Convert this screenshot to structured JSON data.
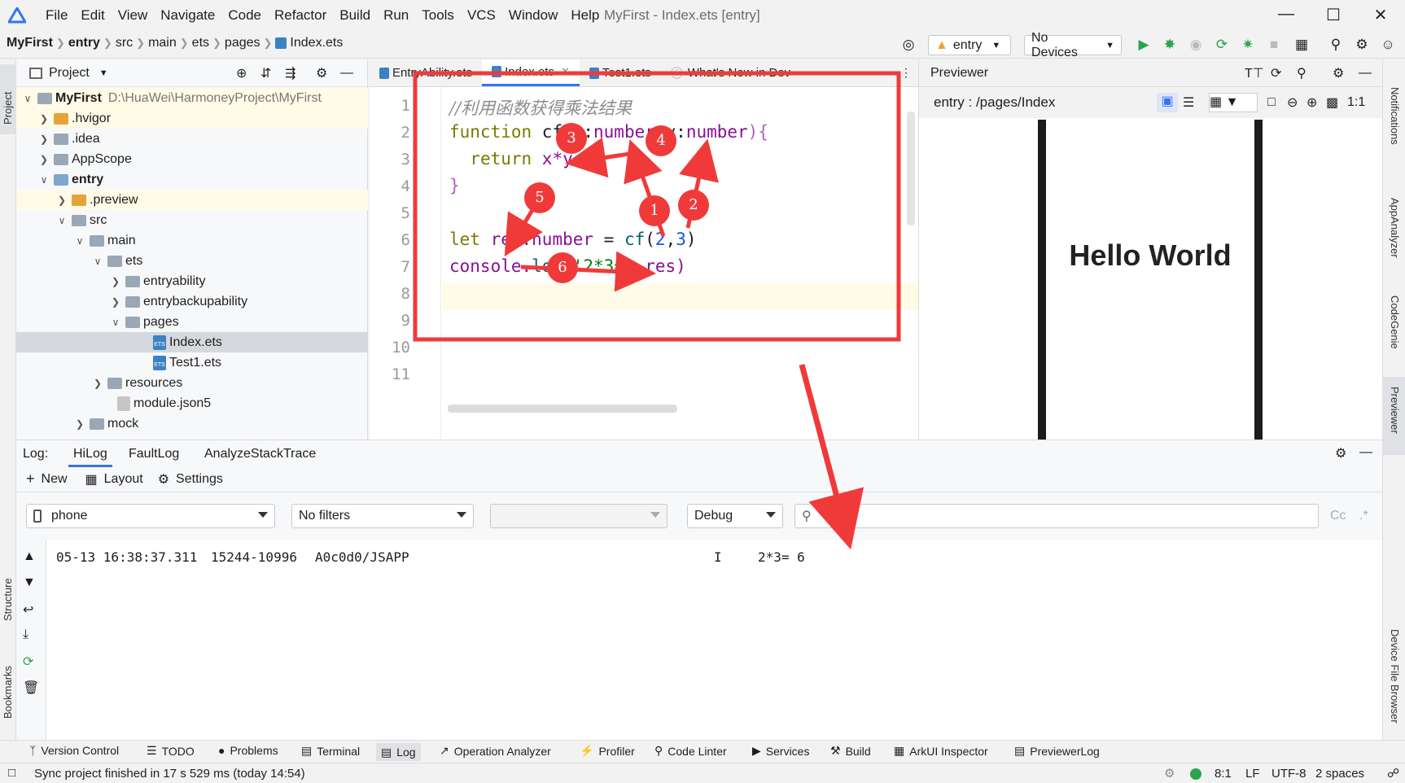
{
  "menubar": {
    "items": [
      "File",
      "Edit",
      "View",
      "Navigate",
      "Code",
      "Refactor",
      "Build",
      "Run",
      "Tools",
      "VCS",
      "Window",
      "Help"
    ],
    "title": "MyFirst - Index.ets [entry]"
  },
  "breadcrumb": [
    "MyFirst",
    "entry",
    "src",
    "main",
    "ets",
    "pages",
    "Index.ets"
  ],
  "toolbar": {
    "module": "entry",
    "device": "No Devices"
  },
  "project": {
    "header": "Project",
    "root_name": "MyFirst",
    "root_path": "D:\\HuaWei\\HarmoneyProject\\MyFirst",
    "rows": [
      ".hvigor",
      ".idea",
      "AppScope",
      "entry",
      ".preview",
      "src",
      "main",
      "ets",
      "entryability",
      "entrybackupability",
      "pages",
      "Index.ets",
      "Test1.ets",
      "resources",
      "module.json5",
      "mock"
    ]
  },
  "editor": {
    "tabs": [
      "EntryAbility.ets",
      "Index.ets",
      "Test1.ets",
      "What's New in Dev"
    ],
    "line_numbers": [
      "1",
      "2",
      "3",
      "4",
      "5",
      "6",
      "7",
      "8",
      "9",
      "10",
      "11"
    ],
    "comment": "//利用函数获得乘法结果",
    "code": {
      "l2_kw": "function",
      "l2_rest_a": " cf(x:",
      "l2_t1": "number",
      "l2_rest_b": ",y:",
      "l2_t2": "number",
      "l2_rest_c": "){",
      "l3_kw": "return",
      "l3_rest": " x*y",
      "l4": "}",
      "l6_kw": "let",
      "l6_a": " res:",
      "l6_t": "number",
      "l6_b": " = ",
      "l6_fn": "cf",
      "l6_c": "(",
      "l6_n1": "2",
      "l6_d": ",",
      "l6_n2": "3",
      "l6_e": ")",
      "l7_a": "console.",
      "l7_fn": "log",
      "l7_b": "(",
      "l7_str": "'2*3='",
      "l7_c": ",res)"
    }
  },
  "previewer": {
    "title": "Previewer",
    "route": "entry : /pages/Index",
    "hello": "Hello World"
  },
  "log": {
    "label": "Log:",
    "tabs": [
      "HiLog",
      "FaultLog",
      "AnalyzeStackTrace"
    ],
    "actions": [
      "New",
      "Layout",
      "Settings"
    ],
    "device": "phone",
    "filter": "No filters",
    "level": "Debug",
    "search_placeholder": "",
    "case_label": "Cc",
    "entry": {
      "date": "05-13 16:38:37.311",
      "pid": "15244-10996",
      "tag": "A0c0d0/JSAPP",
      "level": "I",
      "message": "2*3= 6"
    }
  },
  "left_strip": [
    "Project",
    "Structure",
    "Bookmarks"
  ],
  "right_strip": [
    "Notifications",
    "AppAnalyzer",
    "CodeGenie",
    "Previewer",
    "Device File Browser"
  ],
  "bottom_tabs": [
    "Version Control",
    "TODO",
    "Problems",
    "Terminal",
    "Log",
    "Operation Analyzer",
    "Profiler",
    "Code Linter",
    "Services",
    "Build",
    "ArkUI Inspector",
    "PreviewerLog"
  ],
  "status": {
    "message": "Sync project finished in 17 s 529 ms (today 14:54)",
    "position": "8:1",
    "line_sep": "LF",
    "encoding": "UTF-8",
    "indent": "2 spaces"
  },
  "annotations": [
    "1",
    "2",
    "3",
    "4",
    "5",
    "6"
  ],
  "colors": {
    "accent": "#3574f0",
    "annotation": "#f03a3a"
  }
}
